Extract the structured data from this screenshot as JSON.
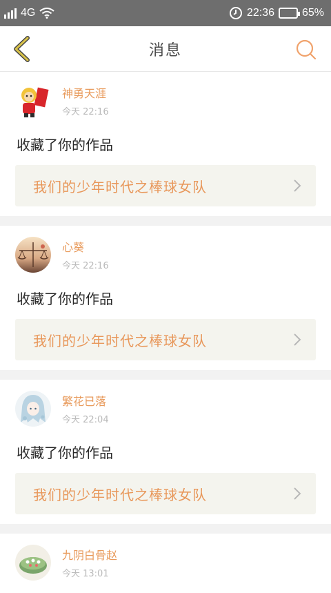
{
  "status_bar": {
    "network": "4G",
    "time": "22:36",
    "battery": "65%",
    "battery_level": 0.65
  },
  "header": {
    "title": "消息",
    "back_icon": "chevron-left-icon",
    "search_icon": "search-icon"
  },
  "messages": [
    {
      "username": "神勇天涯",
      "time": "今天 22:16",
      "action": "收藏了你的作品",
      "work_title": "我们的少年时代之棒球女队"
    },
    {
      "username": "心葵",
      "time": "今天 22:16",
      "action": "收藏了你的作品",
      "work_title": "我们的少年时代之棒球女队"
    },
    {
      "username": "繁花已落",
      "time": "今天 22:04",
      "action": "收藏了你的作品",
      "work_title": "我们的少年时代之棒球女队"
    },
    {
      "username": "九阴白骨赵",
      "time": "今天 13:01"
    }
  ],
  "colors": {
    "accent": "#e8975a",
    "status_bar": "#6e6e6e",
    "link_bg": "#f4f4ee",
    "back_icon": "#d8b94a"
  }
}
